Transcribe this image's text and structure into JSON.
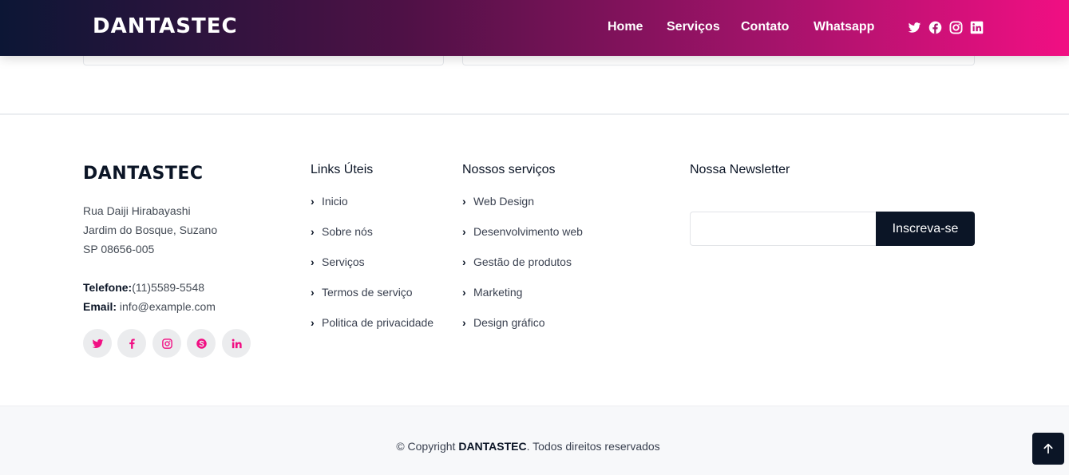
{
  "header": {
    "logo": "DANTASTEC",
    "nav": [
      "Home",
      "Serviços",
      "Contato",
      "Whatsapp"
    ],
    "social_icons": [
      "twitter-icon",
      "facebook-icon",
      "instagram-icon",
      "linkedin-icon"
    ]
  },
  "footer": {
    "brand": "DANTASTEC",
    "address": [
      "Rua Daiji Hirabayashi",
      "Jardim do Bosque, Suzano",
      "SP 08656-005"
    ],
    "phone_label": "Telefone:",
    "phone": "(11)5589-5548",
    "email_label": "Email:",
    "email": "info@example.com",
    "social_icons": [
      "twitter-icon",
      "facebook-icon",
      "instagram-icon",
      "skype-icon",
      "linkedin-icon"
    ],
    "links_title": "Links Úteis",
    "links": [
      "Inicio",
      "Sobre nós",
      "Serviços",
      "Termos de serviço",
      "Politica de privacidade"
    ],
    "services_title": "Nossos serviços",
    "services": [
      "Web Design",
      "Desenvolvimento web",
      "Gestão de produtos",
      "Marketing",
      "Design gráfico"
    ],
    "newsletter_title": "Nossa Newsletter",
    "newsletter_value": "",
    "newsletter_button": "Inscreva-se"
  },
  "bottom": {
    "copyright_prefix": "© Copyright",
    "copyright_brand": "DANTASTEC",
    "copyright_suffix": ". Todos direitos reservados"
  },
  "colors": {
    "accent": "#f10f83",
    "dark": "#0b1526",
    "header_gradient_start": "#0c1635",
    "header_gradient_end": "#f10f83"
  }
}
